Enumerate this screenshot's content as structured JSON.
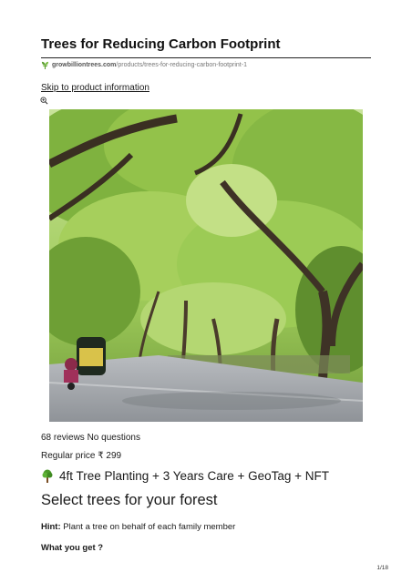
{
  "document": {
    "title": "Trees for Reducing Carbon Footprint",
    "source": {
      "domain": "growbilliontrees.com",
      "path": "/products/trees-for-reducing-carbon-footprint-1"
    },
    "skip_link": "Skip to product information"
  },
  "product": {
    "image_icon": "zoom-icon",
    "reviews": "68 reviews No questions",
    "price_label": "Regular price",
    "price_value": "₹ 299",
    "variant_icon": "tree-icon",
    "variant_text": "4ft Tree Planting + 3 Years Care + GeoTag + NFT",
    "section_heading": "Select trees for your forest",
    "hint_label": "Hint:",
    "hint_text": "Plant a tree on behalf of each family member",
    "what_you_get": "What you get ?"
  },
  "footer": {
    "page_number": "1/18"
  },
  "colors": {
    "text": "#1a1a1a",
    "muted": "#777777",
    "logo_green": "#5a9e2f"
  }
}
